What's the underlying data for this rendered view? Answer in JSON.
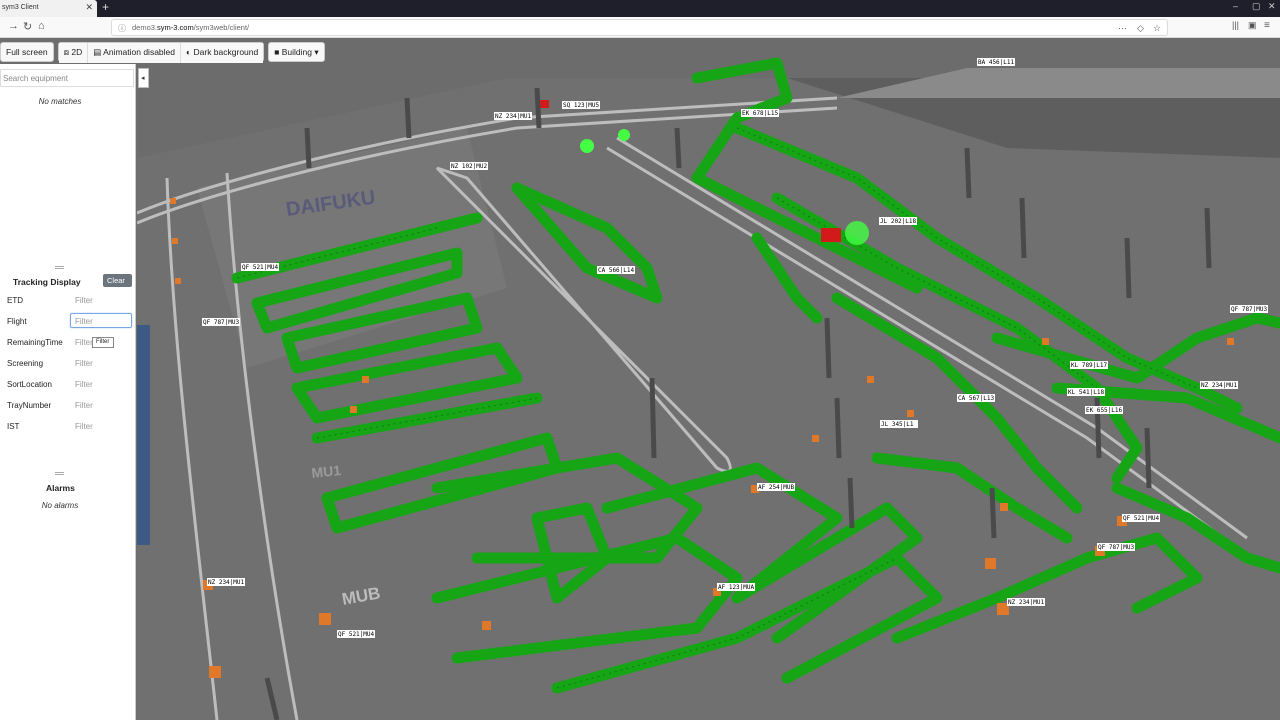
{
  "browser": {
    "tab_title": "sym3 Client",
    "url_prefix": "demo3.",
    "url_host": "sym-3.com",
    "url_path": "/sym3web/client/"
  },
  "toolbar": {
    "fullscreen": "Full screen",
    "view2d": "2D",
    "animation": "Animation disabled",
    "background": "Dark background",
    "building": "Building"
  },
  "sidebar": {
    "search_placeholder": "Search equipment",
    "no_matches": "No matches",
    "tracking_title": "Tracking Display",
    "clear": "Clear",
    "filter_placeholder": "Filter",
    "filters": [
      "ETD",
      "Flight",
      "RemainingTime",
      "Screening",
      "SortLocation",
      "TrayNumber",
      "IST"
    ],
    "tooltip": "Filter",
    "alarms_title": "Alarms",
    "no_alarms": "No alarms"
  },
  "scene": {
    "floor_labels": [
      "DAIFUKU",
      "MU1",
      "MUB"
    ],
    "bag_tags": [
      "NZ 234|MU1",
      "QF 521|MU4",
      "NZ 102|MU2",
      "QF 787|MU3",
      "EK 678|L15",
      "CA 567|L13",
      "SQ 123|MU5",
      "BA 456|L11",
      "JL 345|L1",
      "AF 254|MUB",
      "KL 541|L18",
      "AF 123|MUA",
      "EK 655|L16",
      "CA 566|L14",
      "KL 789|L17",
      "JL 202|L18",
      "BA 456|L11"
    ]
  },
  "colors": {
    "conveyor": "#15a515",
    "bag": "#e0782a",
    "alarm": "#d21a1a",
    "floor": "#6c6c6c"
  }
}
